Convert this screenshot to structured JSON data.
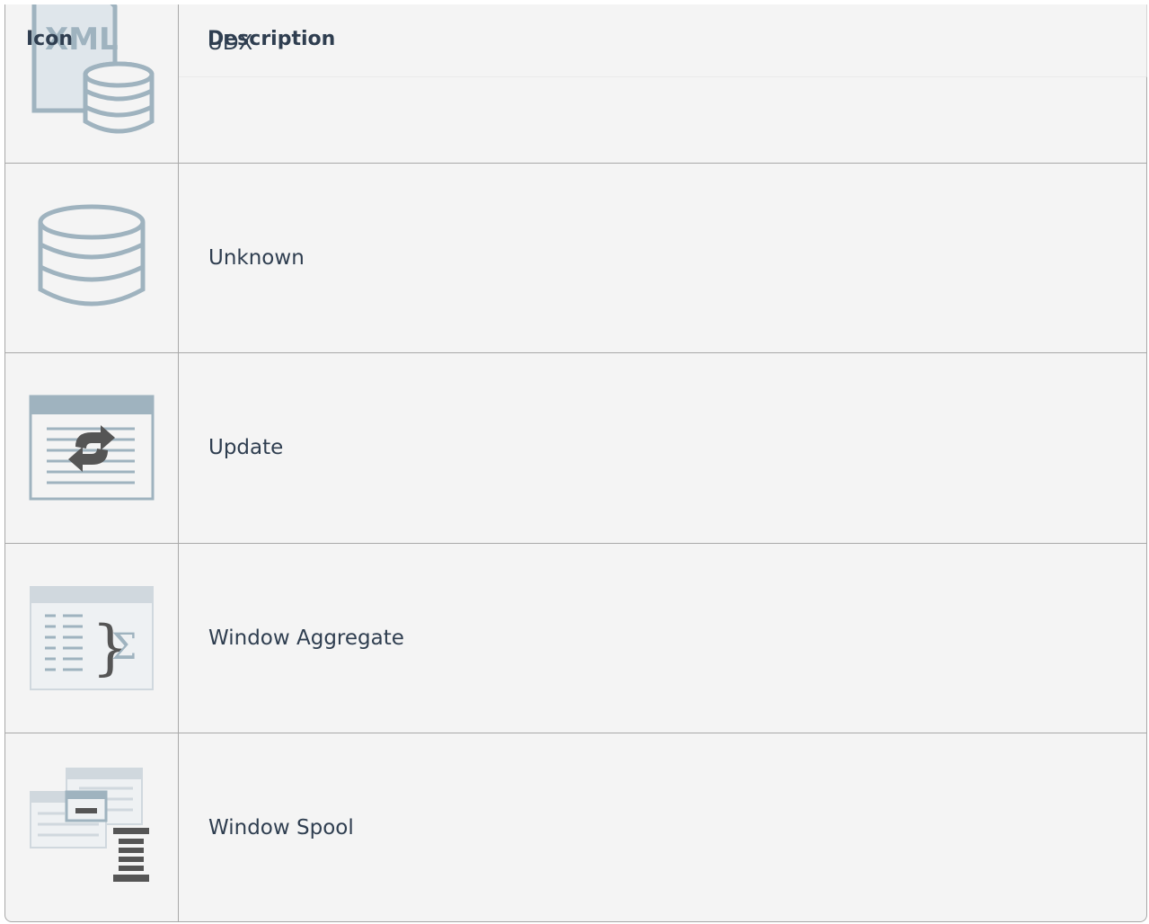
{
  "table": {
    "headers": {
      "icon": "Icon",
      "description": "Description"
    },
    "rows": [
      {
        "icon": "xml-database-icon",
        "description": "UDX"
      },
      {
        "icon": "database-icon",
        "description": "Unknown"
      },
      {
        "icon": "table-update-icon",
        "description": "Update"
      },
      {
        "icon": "window-aggregate-icon",
        "description": "Window Aggregate"
      },
      {
        "icon": "window-spool-icon",
        "description": "Window Spool"
      }
    ]
  },
  "colors": {
    "icon_stroke": "#9fb3bf",
    "icon_fill": "#dfe6eb",
    "icon_dark": "#555555",
    "border": "#a8a8a8",
    "background": "#f4f4f4"
  }
}
